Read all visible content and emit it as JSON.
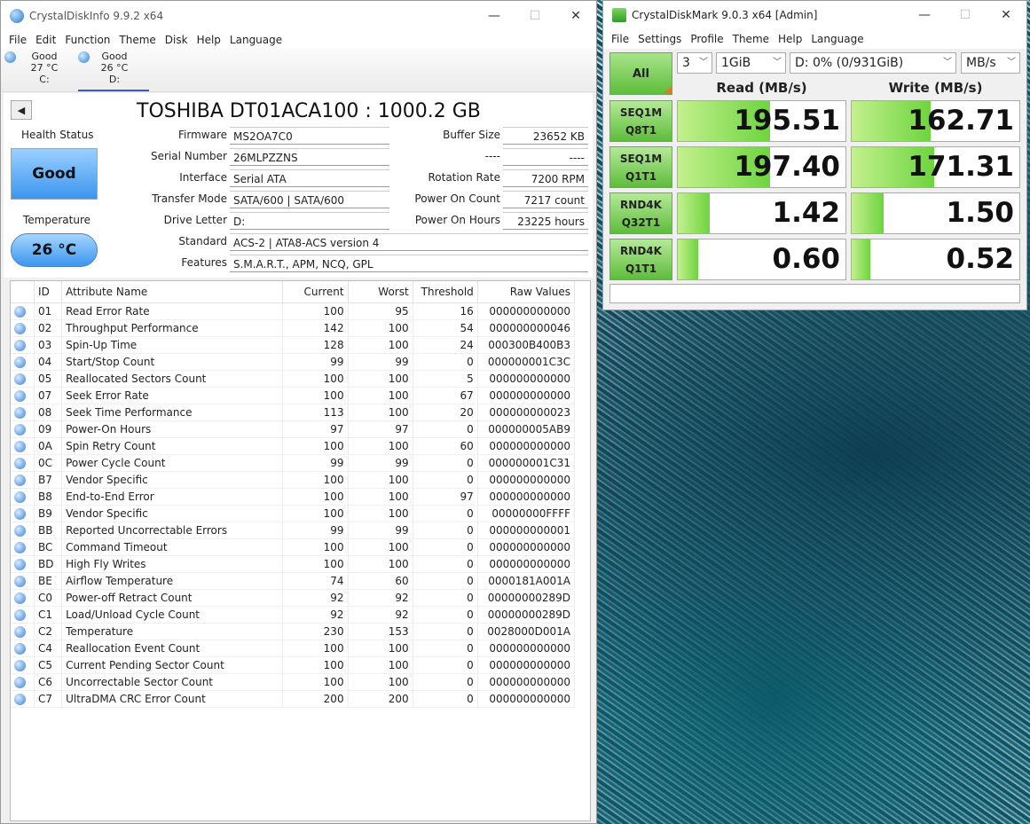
{
  "cdi": {
    "title": "CrystalDiskInfo 9.9.2 x64",
    "menu": [
      "File",
      "Edit",
      "Function",
      "Theme",
      "Disk",
      "Help",
      "Language"
    ],
    "disks": [
      {
        "status": "Good",
        "temp": "27 °C",
        "letter": "C:"
      },
      {
        "status": "Good",
        "temp": "26 °C",
        "letter": "D:"
      }
    ],
    "model": "TOSHIBA DT01ACA100 : 1000.2 GB",
    "health_label": "Health Status",
    "health_value": "Good",
    "temp_label": "Temperature",
    "temp_value": "26 °C",
    "left_fields": [
      {
        "label": "Firmware",
        "value": "MS2OA7C0"
      },
      {
        "label": "Serial Number",
        "value": "26MLPZZNS"
      },
      {
        "label": "Interface",
        "value": "Serial ATA"
      },
      {
        "label": "Transfer Mode",
        "value": "SATA/600 | SATA/600"
      },
      {
        "label": "Drive Letter",
        "value": "D:"
      }
    ],
    "right_fields": [
      {
        "label": "Buffer Size",
        "value": "23652 KB"
      },
      {
        "label": "----",
        "value": "----"
      },
      {
        "label": "Rotation Rate",
        "value": "7200 RPM"
      },
      {
        "label": "Power On Count",
        "value": "7217 count"
      },
      {
        "label": "Power On Hours",
        "value": "23225 hours"
      }
    ],
    "standard_label": "Standard",
    "standard_value": "ACS-2 | ATA8-ACS version 4",
    "features_label": "Features",
    "features_value": "S.M.A.R.T., APM, NCQ, GPL",
    "smart_headers": [
      "ID",
      "Attribute Name",
      "Current",
      "Worst",
      "Threshold",
      "Raw Values"
    ],
    "smart_rows": [
      [
        "01",
        "Read Error Rate",
        "100",
        "95",
        "16",
        "000000000000"
      ],
      [
        "02",
        "Throughput Performance",
        "142",
        "100",
        "54",
        "000000000046"
      ],
      [
        "03",
        "Spin-Up Time",
        "128",
        "100",
        "24",
        "000300B400B3"
      ],
      [
        "04",
        "Start/Stop Count",
        "99",
        "99",
        "0",
        "000000001C3C"
      ],
      [
        "05",
        "Reallocated Sectors Count",
        "100",
        "100",
        "5",
        "000000000000"
      ],
      [
        "07",
        "Seek Error Rate",
        "100",
        "100",
        "67",
        "000000000000"
      ],
      [
        "08",
        "Seek Time Performance",
        "113",
        "100",
        "20",
        "000000000023"
      ],
      [
        "09",
        "Power-On Hours",
        "97",
        "97",
        "0",
        "000000005AB9"
      ],
      [
        "0A",
        "Spin Retry Count",
        "100",
        "100",
        "60",
        "000000000000"
      ],
      [
        "0C",
        "Power Cycle Count",
        "99",
        "99",
        "0",
        "000000001C31"
      ],
      [
        "B7",
        "Vendor Specific",
        "100",
        "100",
        "0",
        "000000000000"
      ],
      [
        "B8",
        "End-to-End Error",
        "100",
        "100",
        "97",
        "000000000000"
      ],
      [
        "B9",
        "Vendor Specific",
        "100",
        "100",
        "0",
        "00000000FFFF"
      ],
      [
        "BB",
        "Reported Uncorrectable Errors",
        "99",
        "99",
        "0",
        "000000000001"
      ],
      [
        "BC",
        "Command Timeout",
        "100",
        "100",
        "0",
        "000000000000"
      ],
      [
        "BD",
        "High Fly Writes",
        "100",
        "100",
        "0",
        "000000000000"
      ],
      [
        "BE",
        "Airflow Temperature",
        "74",
        "60",
        "0",
        "0000181A001A"
      ],
      [
        "C0",
        "Power-off Retract Count",
        "92",
        "92",
        "0",
        "00000000289D"
      ],
      [
        "C1",
        "Load/Unload Cycle Count",
        "92",
        "92",
        "0",
        "00000000289D"
      ],
      [
        "C2",
        "Temperature",
        "230",
        "153",
        "0",
        "0028000D001A"
      ],
      [
        "C4",
        "Reallocation Event Count",
        "100",
        "100",
        "0",
        "000000000000"
      ],
      [
        "C5",
        "Current Pending Sector Count",
        "100",
        "100",
        "0",
        "000000000000"
      ],
      [
        "C6",
        "Uncorrectable Sector Count",
        "100",
        "100",
        "0",
        "000000000000"
      ],
      [
        "C7",
        "UltraDMA CRC Error Count",
        "200",
        "200",
        "0",
        "000000000000"
      ]
    ]
  },
  "cdm": {
    "title": "CrystalDiskMark 9.0.3 x64 [Admin]",
    "menu": [
      "File",
      "Settings",
      "Profile",
      "Theme",
      "Help",
      "Language"
    ],
    "all_label": "All",
    "count": "3",
    "size": "1GiB",
    "drive": "D: 0% (0/931GiB)",
    "unit": "MB/s",
    "read_header": "Read (MB/s)",
    "write_header": "Write (MB/s)",
    "tests": [
      {
        "line1": "SEQ1M",
        "line2": "Q8T1",
        "read": "195.51",
        "write": "162.71",
        "read_fill": 0.55,
        "write_fill": 0.47
      },
      {
        "line1": "SEQ1M",
        "line2": "Q1T1",
        "read": "197.40",
        "write": "171.31",
        "read_fill": 0.55,
        "write_fill": 0.49
      },
      {
        "line1": "RND4K",
        "line2": "Q32T1",
        "read": "1.42",
        "write": "1.50",
        "read_fill": 0.19,
        "write_fill": 0.19
      },
      {
        "line1": "RND4K",
        "line2": "Q1T1",
        "read": "0.60",
        "write": "0.52",
        "read_fill": 0.12,
        "write_fill": 0.11
      }
    ]
  }
}
